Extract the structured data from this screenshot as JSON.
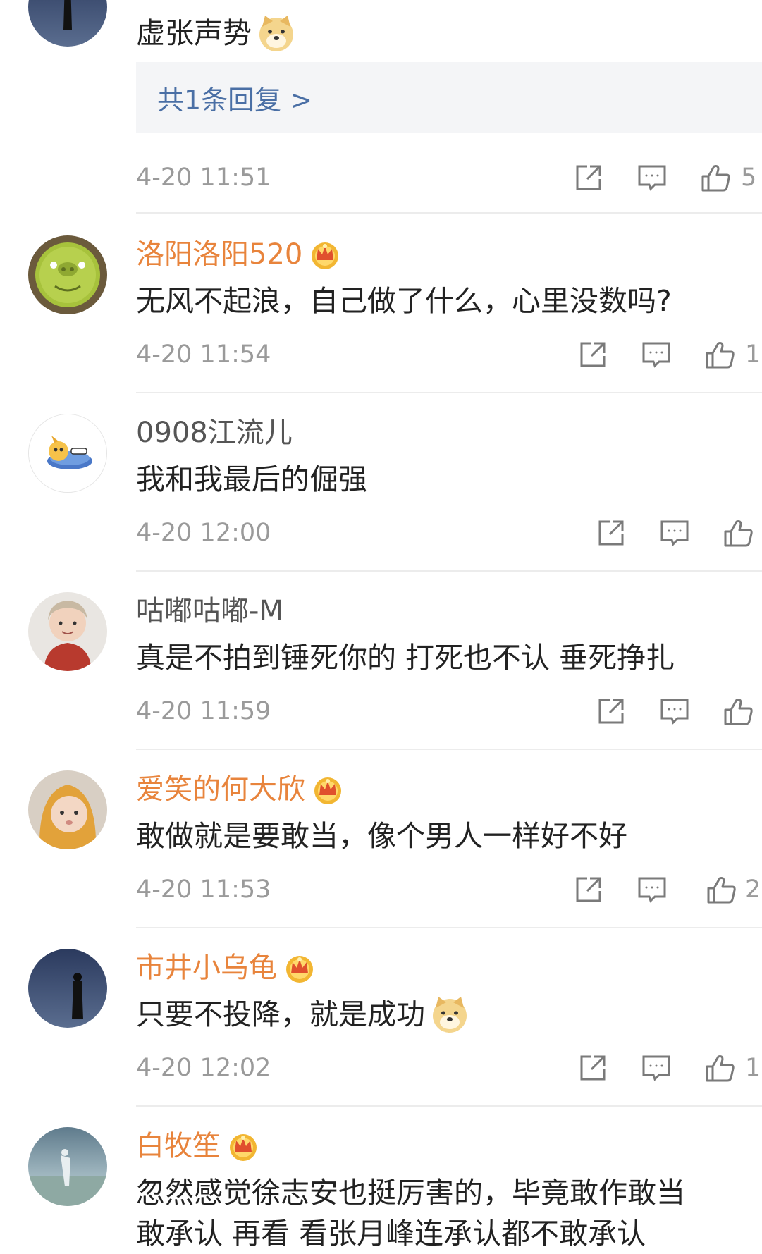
{
  "comments": [
    {
      "username": "",
      "vip": false,
      "text": "虚张声势",
      "emoji": "doge-emoji",
      "reply_link": "共1条回复 >",
      "time": "4-20 11:51",
      "likes": "5"
    },
    {
      "username": "洛阳洛阳520",
      "vip": true,
      "text": "无风不起浪，自己做了什么，心里没数吗?",
      "time": "4-20 11:54",
      "likes": "1"
    },
    {
      "username": "0908江流儿",
      "vip": false,
      "text": "我和我最后的倔强",
      "time": "4-20 12:00",
      "likes": ""
    },
    {
      "username": "咕嘟咕嘟-M",
      "vip": false,
      "text": "真是不拍到锤死你的 打死也不认 垂死挣扎",
      "time": "4-20 11:59",
      "likes": ""
    },
    {
      "username": "爱笑的何大欣",
      "vip": true,
      "text": "敢做就是要敢当，像个男人一样好不好",
      "time": "4-20 11:53",
      "likes": "2"
    },
    {
      "username": "市井小乌龟",
      "vip": true,
      "text": "只要不投降，就是成功",
      "emoji": "doge-emoji",
      "time": "4-20 12:02",
      "likes": "1"
    },
    {
      "username": "白牧笙",
      "vip": true,
      "text": "忽然感觉徐志安也挺厉害的，毕竟敢作敢当",
      "text2": "敢承认 再看 看张月峰连承认都不敢承认"
    }
  ],
  "colors": {
    "vip_name": "#e8843c",
    "normal_name": "#555555",
    "reply_link": "#4a6fa5",
    "meta": "#9a9a9a",
    "divider": "#ececec"
  },
  "icons": [
    "share-icon",
    "comment-icon",
    "like-icon",
    "vip-crown-icon",
    "doge-emoji"
  ]
}
